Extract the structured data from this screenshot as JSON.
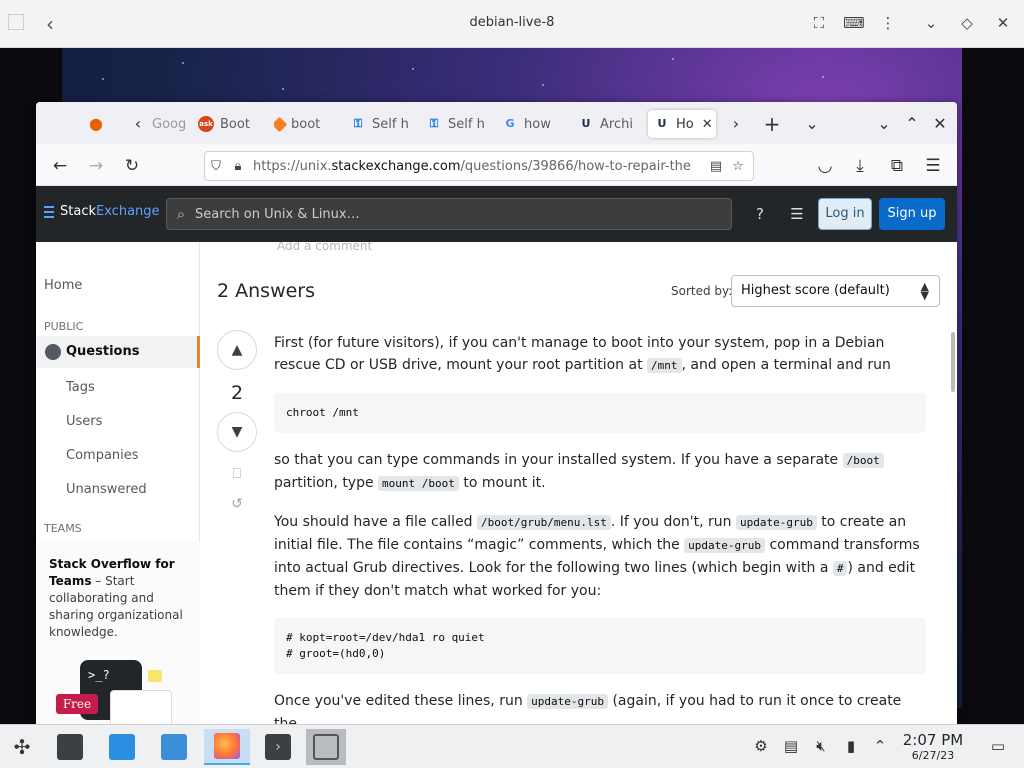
{
  "vm": {
    "title": "debian-live-8"
  },
  "tabs": [
    {
      "label": "Goog",
      "color": "#ffffff"
    },
    {
      "label": "Boot",
      "icon_text": "ask",
      "color": "#d3461e"
    },
    {
      "label": "boot",
      "color": "#f48225"
    },
    {
      "label": "Self h",
      "color": "#1a73e8"
    },
    {
      "label": "Self h",
      "color": "#1a73e8"
    },
    {
      "label": "how",
      "color": "#4285f4"
    },
    {
      "label": "Archi",
      "color": "#1f2f4a"
    },
    {
      "label": "Ho",
      "color": "#1f2f4a"
    }
  ],
  "url": {
    "prefix": "https://unix.",
    "domain": "stackexchange.com",
    "rest": "/questions/39866/how-to-repair-the"
  },
  "se": {
    "logo_stack": "Stack",
    "logo_exchange": "Exchange",
    "search_placeholder": "Search on Unix & Linux…",
    "login": "Log in",
    "signup": "Sign up"
  },
  "sidebar": {
    "home": "Home",
    "public": "PUBLIC",
    "questions": "Questions",
    "tags": "Tags",
    "users": "Users",
    "companies": "Companies",
    "unanswered": "Unanswered",
    "teams": "TEAMS",
    "teams_bold": "Stack Overflow for Teams",
    "teams_text": " – Start collaborating and sharing organizational knowledge.",
    "promo_prompt": ">_?",
    "promo_free": "Free"
  },
  "main": {
    "add_comment": "Add a comment",
    "answers_title": "2 Answers",
    "sorted_by": "Sorted by:",
    "sort_value": "Highest score (default)",
    "vote_count": "2"
  },
  "post": {
    "p1a": "First (for future visitors), if you can't manage to boot into your system, pop in a Debian rescue CD or USB drive, mount your root partition at ",
    "p1code": "/mnt",
    "p1b": ", and open a terminal and run",
    "pre1": "chroot /mnt",
    "p2a": "so that you can type commands in your installed system. If you have a separate ",
    "p2code1": "/boot",
    "p2b": " partition, type ",
    "p2code2": "mount /boot",
    "p2c": " to mount it.",
    "p3a": "You should have a file called ",
    "p3code1": "/boot/grub/menu.lst",
    "p3b": ". If you don't, run ",
    "p3code2": "update-grub",
    "p3c": " to create an initial file. The file contains “magic” comments, which the ",
    "p3code3": "update-grub",
    "p3d": " command transforms into actual Grub directives. Look for the following two lines (which begin with a ",
    "p3code4": "#",
    "p3e": ") and edit them if they don't match what worked for you:",
    "pre2": "# kopt=root=/dev/hda1 ro quiet\n# groot=(hd0,0)",
    "p4a": "Once you've edited these lines, run ",
    "p4code": "update-grub",
    "p4b": " (again, if you had to run it once to create the"
  },
  "taskbar": {
    "time": "2:07 PM",
    "date": "6/27/23"
  }
}
